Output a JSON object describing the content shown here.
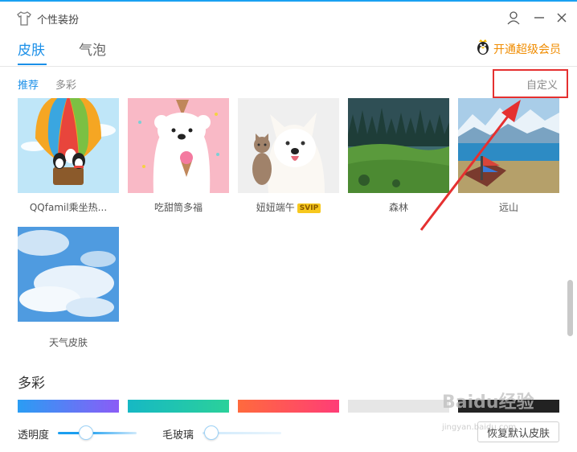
{
  "window": {
    "title": "个性装扮"
  },
  "tabs": [
    {
      "label": "皮肤",
      "active": true
    },
    {
      "label": "气泡",
      "active": false
    }
  ],
  "vip": {
    "label": "开通超级会员"
  },
  "subtabs": {
    "recommend": "推荐",
    "colorful": "多彩",
    "custom": "自定义"
  },
  "skins": [
    {
      "caption": "QQfamil乘坐热...",
      "theme": "hot-air-balloon"
    },
    {
      "caption": "吃甜筒多福",
      "theme": "polar-bear-icecream"
    },
    {
      "caption": "妞妞端午",
      "badge": "SVIP",
      "theme": "dog-and-cat"
    },
    {
      "caption": "森林",
      "theme": "forest"
    },
    {
      "caption": "远山",
      "theme": "distant-mountains"
    },
    {
      "caption": "天气皮肤",
      "theme": "clouds"
    }
  ],
  "colorful_section": {
    "title": "多彩",
    "swatches": [
      "#2a9df4",
      "#16b8c4",
      "#ff6a3d",
      "#e6e6e6",
      "#222222"
    ]
  },
  "controls": {
    "transparency_label": "透明度",
    "transparency_value": 0.35,
    "frost_label": "毛玻璃",
    "frost_value": 0.0,
    "reset_label": "恢复默认皮肤"
  },
  "watermark": {
    "main": "Baidu经验",
    "sub": "jingyan.baidu.com"
  },
  "colors": {
    "accent": "#1a8fe8",
    "vip": "#f08c00",
    "annotation": "#e53030"
  }
}
